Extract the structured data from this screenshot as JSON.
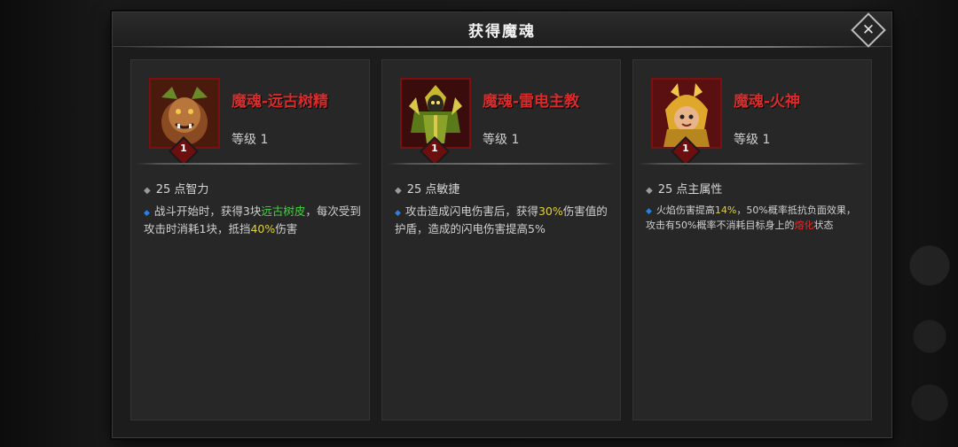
{
  "modal": {
    "title": "获得魔魂",
    "close_glyph": "✕"
  },
  "cards": [
    {
      "name": "魔魂-远古树精",
      "level": "等级 1",
      "badge": "1",
      "stat": "25 点智力",
      "desc": [
        "战斗开始时，获得3块",
        "远古树皮",
        "，每次受到攻击时消耗1块，抵挡",
        "40%",
        "伤害"
      ]
    },
    {
      "name": "魔魂-雷电主教",
      "level": "等级 1",
      "badge": "1",
      "stat": "25 点敏捷",
      "desc": [
        "攻击造成闪电伤害后，获得",
        "30%",
        "伤害值的护盾，造成的闪电伤害提高5%"
      ]
    },
    {
      "name": "魔魂-火神",
      "level": "等级 1",
      "badge": "1",
      "stat": "25 点主属性",
      "desc": [
        "火焰伤害提高",
        "14%",
        "，50%概率抵抗负面效果，攻击有50%概率不消耗目标身上的",
        "熔化",
        "状态"
      ]
    }
  ],
  "colors": {
    "name_red": "#d92b2b",
    "highlight_green": "#3fd43f",
    "highlight_yellow": "#e0d23a",
    "highlight_red": "#e02a2a",
    "bullet_blue": "#2a7fe0"
  },
  "icons": {
    "close": "close-icon",
    "stat_bullet": "diamond-bullet-icon",
    "desc_bullet": "blue-diamond-bullet-icon"
  }
}
